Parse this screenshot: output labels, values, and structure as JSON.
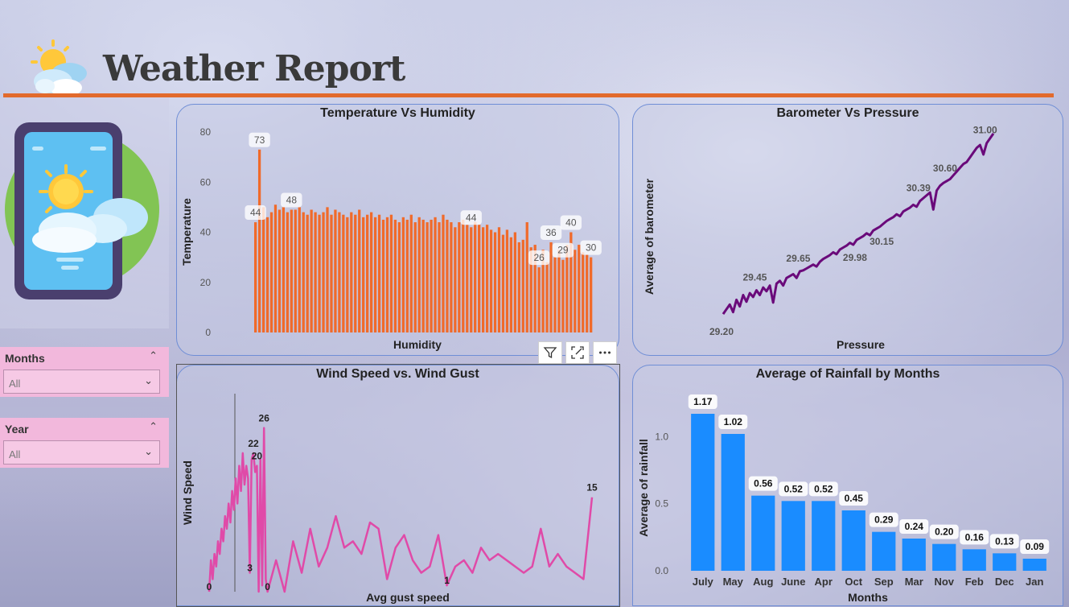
{
  "header": {
    "title": "Weather Report",
    "logo_icon": "sun-cloud-icon"
  },
  "filters": [
    {
      "label": "Months",
      "value": "All"
    },
    {
      "label": "Year",
      "value": "All"
    }
  ],
  "colors": {
    "accent_line": "#e26a2c",
    "bar_orange": "#f06a2a",
    "line_purple": "#6a0a7a",
    "line_pink": "#e04aa8",
    "bar_blue": "#1a8cff",
    "slicer_pink": "#f2b8dc"
  },
  "toolbar_icons": [
    "filter-icon",
    "focus-mode-icon",
    "more-options-icon"
  ],
  "chart_data": [
    {
      "type": "bar",
      "title": "Temperature Vs Humidity",
      "xlabel": "Humidity",
      "ylabel": "Temperature",
      "ylim": [
        0,
        80
      ],
      "yticks": [
        0,
        20,
        40,
        60,
        80
      ],
      "values": [
        44,
        73,
        50,
        46,
        48,
        51,
        49,
        50,
        48,
        49,
        49,
        50,
        48,
        47,
        49,
        48,
        47,
        48,
        50,
        47,
        49,
        48,
        47,
        46,
        48,
        47,
        49,
        46,
        47,
        48,
        46,
        47,
        45,
        46,
        47,
        45,
        44,
        46,
        45,
        47,
        44,
        46,
        45,
        44,
        45,
        46,
        44,
        47,
        45,
        44,
        42,
        44,
        45,
        43,
        42,
        44,
        43,
        42,
        43,
        41,
        40,
        42,
        39,
        41,
        38,
        40,
        36,
        37,
        44,
        34,
        35,
        26,
        33,
        28,
        36,
        30,
        33,
        29,
        35,
        40,
        33,
        35,
        32,
        31,
        30
      ],
      "data_labels": [
        {
          "index": 0,
          "text": "44"
        },
        {
          "index": 1,
          "text": "73"
        },
        {
          "index": 9,
          "text": "48"
        },
        {
          "index": 54,
          "text": "44"
        },
        {
          "index": 71,
          "text": "26"
        },
        {
          "index": 74,
          "text": "36"
        },
        {
          "index": 77,
          "text": "29"
        },
        {
          "index": 79,
          "text": "40"
        },
        {
          "index": 84,
          "text": "30"
        }
      ]
    },
    {
      "type": "line",
      "title": "Barometer Vs Pressure",
      "xlabel": "Pressure",
      "ylabel": "Average of barometer",
      "ylim": [
        29.15,
        31.15
      ],
      "values": [
        29.2,
        29.25,
        29.3,
        29.22,
        29.35,
        29.28,
        29.4,
        29.33,
        29.42,
        29.38,
        29.45,
        29.4,
        29.48,
        29.44,
        29.5,
        29.32,
        29.52,
        29.55,
        29.5,
        29.58,
        29.6,
        29.62,
        29.58,
        29.65,
        29.66,
        29.68,
        29.7,
        29.72,
        29.7,
        29.75,
        29.78,
        29.8,
        29.82,
        29.85,
        29.83,
        29.88,
        29.9,
        29.92,
        29.95,
        29.93,
        29.98,
        30.0,
        30.02,
        30.05,
        30.03,
        30.08,
        30.1,
        30.12,
        30.15,
        30.18,
        30.2,
        30.22,
        30.25,
        30.23,
        30.28,
        30.3,
        30.32,
        30.35,
        30.33,
        30.39,
        30.42,
        30.45,
        30.48,
        30.3,
        30.5,
        30.55,
        30.58,
        30.6,
        30.62,
        30.66,
        30.7,
        30.74,
        30.78,
        30.8,
        30.85,
        30.9,
        30.95,
        30.98,
        30.88,
        31.0,
        31.05,
        31.1
      ],
      "data_labels": [
        {
          "index": 0,
          "text": "29.20"
        },
        {
          "index": 10,
          "text": "29.45"
        },
        {
          "index": 23,
          "text": "29.65"
        },
        {
          "index": 40,
          "text": "29.98"
        },
        {
          "index": 48,
          "text": "30.15"
        },
        {
          "index": 59,
          "text": "30.39"
        },
        {
          "index": 67,
          "text": "30.60"
        },
        {
          "index": 79,
          "text": "31.00"
        }
      ]
    },
    {
      "type": "line",
      "title": "Wind Speed vs. Wind Gust",
      "xlabel": "Avg gust speed",
      "ylabel": "Wind Speed",
      "ylim": [
        0,
        28
      ],
      "values": [
        0,
        5,
        2,
        6,
        4,
        8,
        6,
        10,
        8,
        12,
        10,
        14,
        11,
        16,
        13,
        18,
        14,
        20,
        16,
        22,
        17,
        20,
        18,
        3,
        21,
        22,
        19,
        20,
        0,
        21,
        1,
        26,
        2,
        0,
        5,
        0,
        8,
        3,
        10,
        4,
        7,
        12,
        7,
        8,
        6,
        11,
        10,
        2,
        7,
        9,
        5,
        3,
        4,
        9,
        1,
        4,
        5,
        3,
        7,
        5,
        6,
        5,
        4,
        3,
        4,
        10,
        4,
        6,
        4,
        3,
        2,
        15
      ],
      "data_labels": [
        {
          "index": 0,
          "text": "0"
        },
        {
          "index": 23,
          "text": "3"
        },
        {
          "index": 25,
          "text": "22"
        },
        {
          "index": 27,
          "text": "20"
        },
        {
          "index": 31,
          "text": "26"
        },
        {
          "index": 33,
          "text": "0"
        },
        {
          "index": 54,
          "text": "1"
        },
        {
          "index": 71,
          "text": "15"
        }
      ]
    },
    {
      "type": "bar",
      "title": "Average of Rainfall by Months",
      "xlabel": "Months",
      "ylabel": "Average of rainfall",
      "ylim": [
        0,
        1.2
      ],
      "yticks": [
        0.0,
        0.5,
        1.0
      ],
      "categories": [
        "July",
        "May",
        "Aug",
        "June",
        "Apr",
        "Oct",
        "Sep",
        "Mar",
        "Nov",
        "Feb",
        "Dec",
        "Jan"
      ],
      "values": [
        1.17,
        1.02,
        0.56,
        0.52,
        0.52,
        0.45,
        0.29,
        0.24,
        0.2,
        0.16,
        0.13,
        0.09
      ],
      "value_labels": [
        "1.17",
        "1.02",
        "0.56",
        "0.52",
        "0.52",
        "0.45",
        "0.29",
        "0.24",
        "0.20",
        "0.16",
        "0.13",
        "0.09"
      ]
    }
  ]
}
